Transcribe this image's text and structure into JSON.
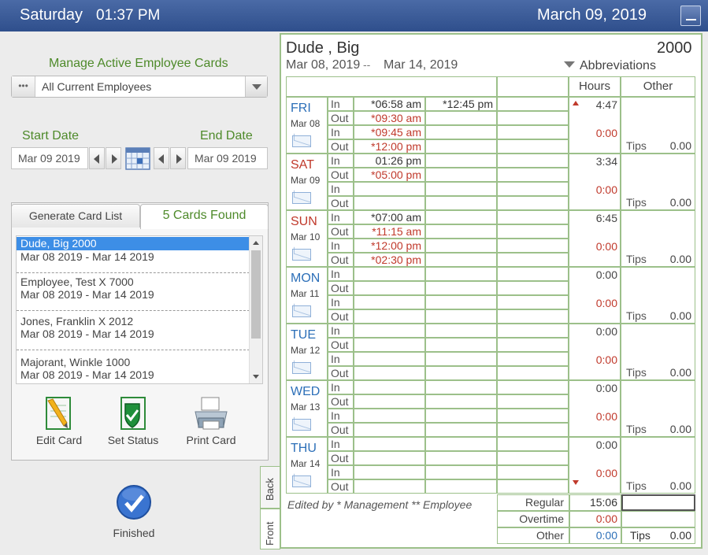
{
  "titlebar": {
    "day": "Saturday",
    "time": "01:37 PM",
    "date": "March 09, 2019"
  },
  "left": {
    "manage_label": "Manage Active Employee Cards",
    "employee_filter": "All Current Employees",
    "dots": "•••",
    "start_label": "Start Date",
    "end_label": "End Date",
    "start_date": "Mar 09 2019",
    "end_date": "Mar 09 2019",
    "tab_generate": "Generate Card List",
    "tab_found": "5 Cards Found",
    "cards": [
      {
        "name": "Dude, Big   2000",
        "range": "Mar 08 2019 - Mar 14 2019",
        "selected": true
      },
      {
        "name": "Employee, Test X  7000",
        "range": "Mar 08 2019 - Mar 14 2019"
      },
      {
        "name": "Jones, Franklin X   2012",
        "range": "Mar 08 2019 - Mar 14 2019"
      },
      {
        "name": "Majorant, Winkle   1000",
        "range": "Mar 08 2019 - Mar 14 2019"
      }
    ],
    "actions": {
      "edit": "Edit Card",
      "status": "Set Status",
      "print": "Print Card"
    },
    "finished": "Finished"
  },
  "sheet": {
    "name": "Dude , Big",
    "number": "2000",
    "from": "Mar 08, 2019",
    "dash": "--",
    "to": "Mar 14, 2019",
    "abbreviations": "Abbreviations",
    "hdr_hours": "Hours",
    "hdr_other": "Other",
    "io": {
      "in": "In",
      "out": "Out"
    },
    "tips_label": "Tips",
    "days": [
      {
        "name": "FRI",
        "date": "Mar 08",
        "hours": "4:47",
        "hours2": "0:00",
        "tips": "0.00",
        "rows": [
          [
            "*06:58 am",
            "*12:45 pm"
          ],
          [
            "*09:30 am",
            ""
          ],
          [
            "*09:45 am",
            ""
          ],
          [
            "*12:00 pm",
            ""
          ]
        ]
      },
      {
        "name": "SAT",
        "date": "Mar 09",
        "hours": "3:34",
        "hours2": "0:00",
        "tips": "0.00",
        "rows": [
          [
            "01:26 pm",
            ""
          ],
          [
            "*05:00 pm",
            ""
          ],
          [
            "",
            ""
          ],
          [
            "",
            ""
          ]
        ]
      },
      {
        "name": "SUN",
        "date": "Mar 10",
        "hours": "6:45",
        "hours2": "0:00",
        "tips": "0.00",
        "rows": [
          [
            "*07:00 am",
            ""
          ],
          [
            "*11:15 am",
            ""
          ],
          [
            "*12:00 pm",
            ""
          ],
          [
            "*02:30 pm",
            ""
          ]
        ]
      },
      {
        "name": "MON",
        "date": "Mar 11",
        "hours": "0:00",
        "hours2": "0:00",
        "tips": "0.00",
        "rows": [
          [
            "",
            ""
          ],
          [
            "",
            ""
          ],
          [
            "",
            ""
          ],
          [
            "",
            ""
          ]
        ]
      },
      {
        "name": "TUE",
        "date": "Mar 12",
        "hours": "0:00",
        "hours2": "0:00",
        "tips": "0.00",
        "rows": [
          [
            "",
            ""
          ],
          [
            "",
            ""
          ],
          [
            "",
            ""
          ],
          [
            "",
            ""
          ]
        ]
      },
      {
        "name": "WED",
        "date": "Mar 13",
        "hours": "0:00",
        "hours2": "0:00",
        "tips": "0.00",
        "rows": [
          [
            "",
            ""
          ],
          [
            "",
            ""
          ],
          [
            "",
            ""
          ],
          [
            "",
            ""
          ]
        ]
      },
      {
        "name": "THU",
        "date": "Mar 14",
        "hours": "0:00",
        "hours2": "0:00",
        "tips": "0.00",
        "rows": [
          [
            "",
            ""
          ],
          [
            "",
            ""
          ],
          [
            "",
            ""
          ],
          [
            "",
            ""
          ]
        ]
      }
    ],
    "edited_by": "Edited by  * Management   ** Employee",
    "summary": {
      "regular_label": "Regular",
      "regular": "15:06",
      "overtime_label": "Overtime",
      "overtime": "0:00",
      "other_label": "Other",
      "other": "0:00",
      "other_tips": "0.00"
    },
    "tab_back": "Back",
    "tab_front": "Front"
  },
  "colors": {
    "accent_green": "#4e8a2a",
    "title_blue": "#2f4f8c",
    "edit_red": "#c0392b",
    "link_blue": "#2c6fb8"
  }
}
